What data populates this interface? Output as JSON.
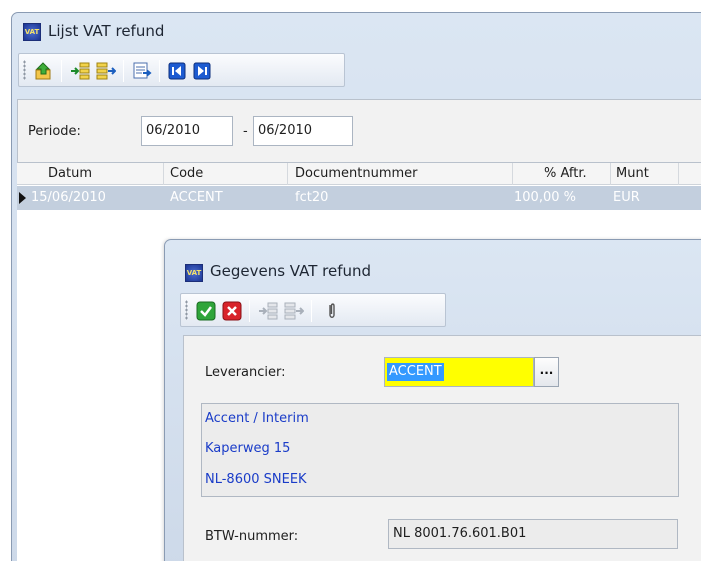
{
  "main_window": {
    "title": "Lijst VAT refund",
    "icon_text": "VAT",
    "toolbar": {
      "buttons": [
        "export-icon",
        "insert-icon",
        "append-icon",
        "report-icon",
        "first-record-icon",
        "last-record-icon"
      ]
    },
    "filter": {
      "periode_label": "Periode:",
      "from_value": "06/2010",
      "range_separator": "-",
      "to_value": "06/2010"
    },
    "grid": {
      "columns": [
        "Datum",
        "Code",
        "Documentnummer",
        "% Aftr.",
        "Munt"
      ],
      "rows": [
        {
          "datum": "15/06/2010",
          "code": "ACCENT",
          "documentnummer": "fct20",
          "aftr": "100,00 %",
          "munt": "EUR"
        }
      ]
    }
  },
  "dialog": {
    "title": "Gegevens VAT refund",
    "icon_text": "VAT",
    "toolbar": {
      "buttons": [
        "confirm-icon",
        "cancel-icon",
        "insert-icon",
        "append-icon",
        "attachment-icon"
      ]
    },
    "leverancier_label": "Leverancier:",
    "leverancier_value": "ACCENT",
    "lookup_button_label": "...",
    "address_lines": [
      "Accent / Interim",
      "Kaperweg 15",
      "NL-8600 SNEEK"
    ],
    "btw_label": "BTW-nummer:",
    "btw_value": "NL 8001.76.601.B01"
  },
  "colors": {
    "selection_row": "#c3cfde",
    "text_selection": "#3399ff",
    "required_field": "#ffff00",
    "address_text": "#1a3cc8"
  }
}
